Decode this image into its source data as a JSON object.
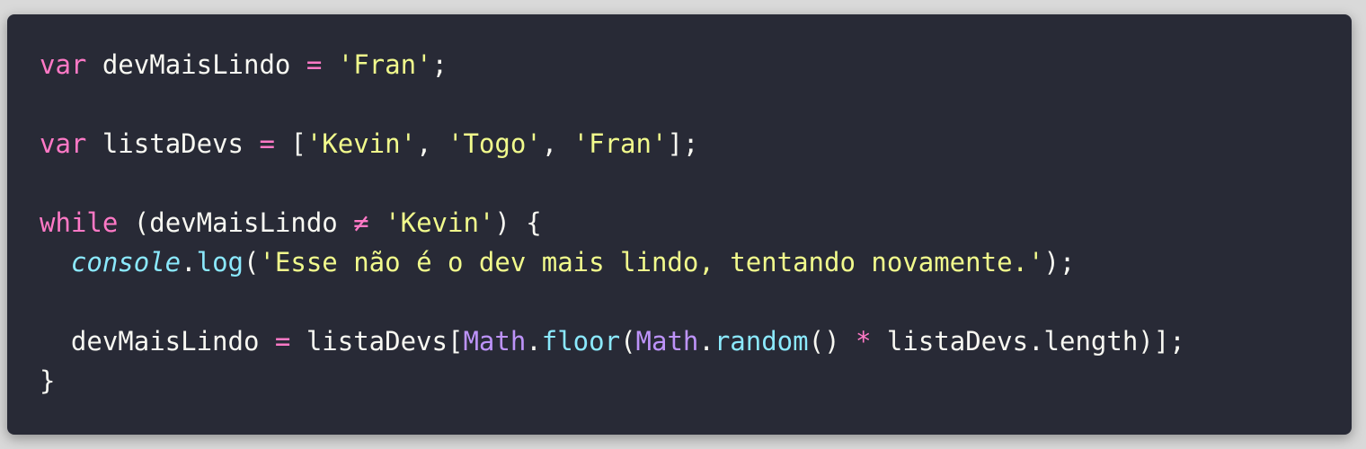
{
  "colors": {
    "background": "#282a36",
    "page_background": "#d9d9d9",
    "keyword": "#ff79c6",
    "string": "#f1fa8c",
    "builtin": "#bd93f9",
    "function": "#8be9fd",
    "plain": "#f8f8f2"
  },
  "code": {
    "language": "javascript",
    "lines": [
      {
        "tokens": [
          {
            "type": "keyword",
            "text": "var"
          },
          {
            "type": "plain",
            "text": " devMaisLindo "
          },
          {
            "type": "operator",
            "text": "="
          },
          {
            "type": "plain",
            "text": " "
          },
          {
            "type": "string",
            "text": "'Fran'"
          },
          {
            "type": "plain",
            "text": ";"
          }
        ]
      },
      {
        "tokens": []
      },
      {
        "tokens": [
          {
            "type": "keyword",
            "text": "var"
          },
          {
            "type": "plain",
            "text": " listaDevs "
          },
          {
            "type": "operator",
            "text": "="
          },
          {
            "type": "plain",
            "text": " ["
          },
          {
            "type": "string",
            "text": "'Kevin'"
          },
          {
            "type": "plain",
            "text": ", "
          },
          {
            "type": "string",
            "text": "'Togo'"
          },
          {
            "type": "plain",
            "text": ", "
          },
          {
            "type": "string",
            "text": "'Fran'"
          },
          {
            "type": "plain",
            "text": "];"
          }
        ]
      },
      {
        "tokens": []
      },
      {
        "tokens": [
          {
            "type": "keyword",
            "text": "while"
          },
          {
            "type": "plain",
            "text": " (devMaisLindo "
          },
          {
            "type": "operator",
            "text": "≠"
          },
          {
            "type": "plain",
            "text": " "
          },
          {
            "type": "string",
            "text": "'Kevin'"
          },
          {
            "type": "plain",
            "text": ") {"
          }
        ]
      },
      {
        "tokens": [
          {
            "type": "plain",
            "text": "  "
          },
          {
            "type": "object",
            "text": "console"
          },
          {
            "type": "plain",
            "text": "."
          },
          {
            "type": "function",
            "text": "log"
          },
          {
            "type": "plain",
            "text": "("
          },
          {
            "type": "string",
            "text": "'Esse não é o dev mais lindo, tentando novamente.'"
          },
          {
            "type": "plain",
            "text": ");"
          }
        ]
      },
      {
        "tokens": []
      },
      {
        "tokens": [
          {
            "type": "plain",
            "text": "  devMaisLindo "
          },
          {
            "type": "operator",
            "text": "="
          },
          {
            "type": "plain",
            "text": " listaDevs["
          },
          {
            "type": "builtin",
            "text": "Math"
          },
          {
            "type": "plain",
            "text": "."
          },
          {
            "type": "function",
            "text": "floor"
          },
          {
            "type": "plain",
            "text": "("
          },
          {
            "type": "builtin",
            "text": "Math"
          },
          {
            "type": "plain",
            "text": "."
          },
          {
            "type": "function",
            "text": "random"
          },
          {
            "type": "plain",
            "text": "() "
          },
          {
            "type": "operator",
            "text": "*"
          },
          {
            "type": "plain",
            "text": " listaDevs.length)];"
          }
        ]
      },
      {
        "tokens": [
          {
            "type": "plain",
            "text": "}"
          }
        ]
      }
    ]
  }
}
